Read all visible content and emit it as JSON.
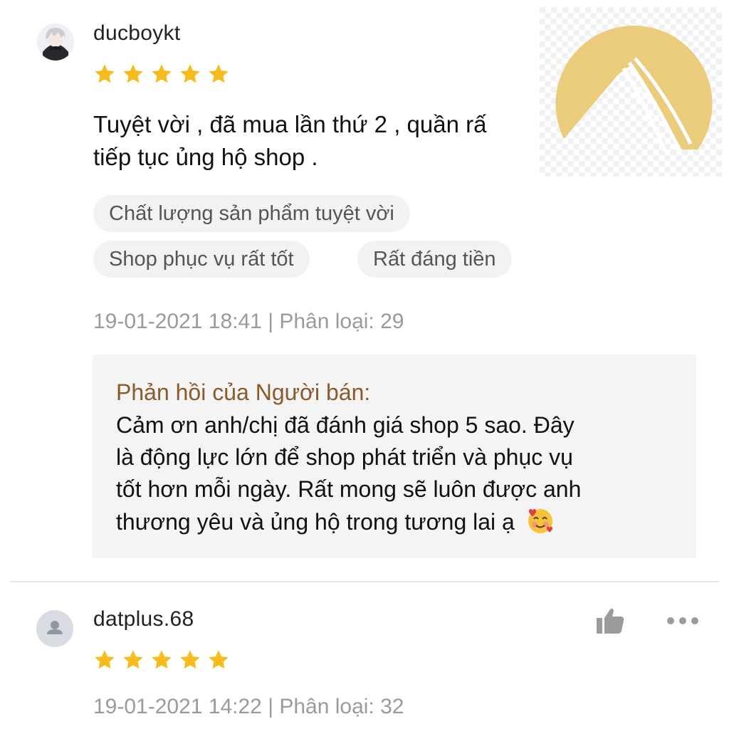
{
  "review1": {
    "username": "ducboykt",
    "rating": 5,
    "text_line1": "Tuyệt vời , đã mua lần thứ 2 , quần rấ",
    "text_line2": "tiếp tục ủng hộ shop .",
    "tags": [
      "Chất lượng sản phẩm tuyệt vời",
      "Shop phục vụ rất tốt",
      "Rất đáng tiền"
    ],
    "meta": "19-01-2021 18:41 | Phân loại: 29",
    "reply": {
      "title": "Phản hồi của Người bán:",
      "line1": "Cảm ơn anh/chị đã đánh giá shop 5 sao. Đây",
      "line2": "là động lực lớn để shop phát triển và phục vụ",
      "line3": "tốt hơn mỗi ngày. Rất mong sẽ luôn được anh",
      "line4": "thương yêu và ủng hộ trong tương lai ạ",
      "emoji": "🥰"
    }
  },
  "review2": {
    "username": "datplus.68",
    "rating": 5,
    "meta": "19-01-2021 14:22 | Phân loại: 32"
  },
  "colors": {
    "star": "#f6bb1e",
    "logo": "#ebcb7c",
    "reply_title": "#8a5a2a",
    "meta": "#9a9a9a"
  }
}
